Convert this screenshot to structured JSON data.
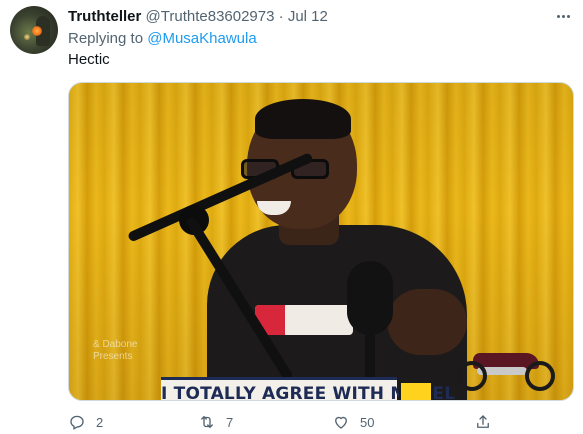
{
  "tweet": {
    "display_name": "Truthteller",
    "handle": "@Truthte83602973",
    "separator": "·",
    "date": "Jul 12",
    "replying_prefix": "Replying to",
    "replying_to": "@MusaKhawula",
    "text": "Hectic"
  },
  "media": {
    "banner_text": "I TOTALLY AGREE WITH MYSEL",
    "watermark_line1": "& Dabone",
    "watermark_line2": "Presents"
  },
  "actions": {
    "reply_count": "2",
    "retweet_count": "7",
    "like_count": "50",
    "share_count": ""
  },
  "icons": {
    "more": "more-dots-icon",
    "reply": "reply-icon",
    "retweet": "retweet-icon",
    "like": "heart-icon",
    "share": "share-icon"
  },
  "colors": {
    "link": "#1d9bf0",
    "muted": "#536471",
    "text": "#0f1419"
  }
}
